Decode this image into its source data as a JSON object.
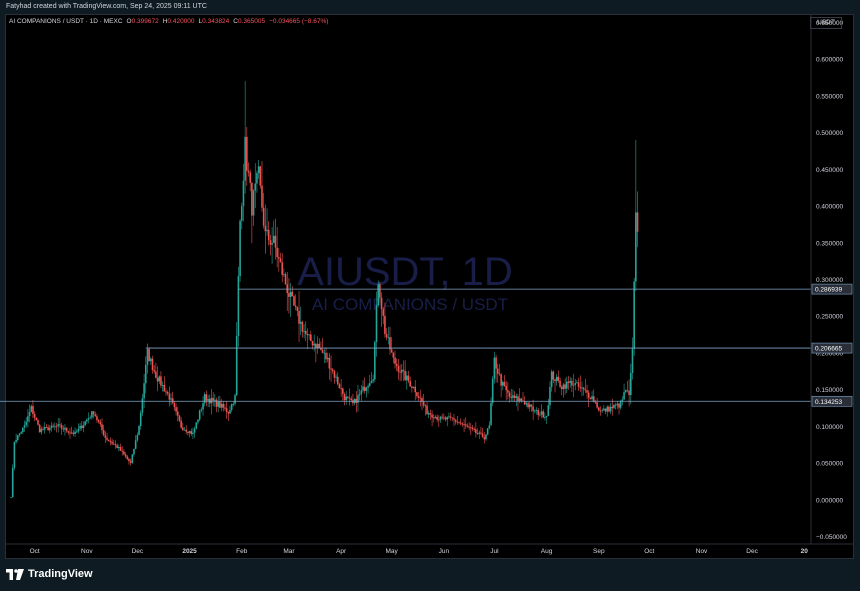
{
  "attribution": "Fatyhad created with TradingView.com, Sep 24, 2025 09:11 UTC",
  "symbol_bar": {
    "title": "AI COMPANIONS / USDT · 1D · MEXC",
    "o_key": "O",
    "o_val": "0.399672",
    "h_key": "H",
    "h_val": "0.420000",
    "l_key": "L",
    "l_val": "0.343824",
    "c_key": "C",
    "c_val": "0.365005",
    "change": "−0.034665 (−8.67%)"
  },
  "currency_badge": "USDT",
  "watermark": {
    "symbol": "AIUSDT, 1D",
    "name": "AI COMPANIONS / USDT"
  },
  "footer": {
    "brand": "TradingView"
  },
  "colors": {
    "up": "#26a69a",
    "down": "#ef5350",
    "background": "#000000",
    "level_line": "#7fa6c9",
    "axis_text": "#d1d4dc"
  },
  "chart_data": {
    "type": "candlestick",
    "symbol": "AIUSDT",
    "timeframe": "1D",
    "exchange": "MEXC",
    "y_axis": {
      "ticks": [
        "0.650000",
        "0.600000",
        "0.550000",
        "0.500000",
        "0.450000",
        "0.400000",
        "0.350000",
        "0.300000",
        "0.250000",
        "0.200000",
        "0.150000",
        "0.100000",
        "0.050000",
        "0.000000",
        "−0.050000"
      ],
      "tick_values": [
        0.65,
        0.6,
        0.55,
        0.5,
        0.45,
        0.4,
        0.35,
        0.3,
        0.25,
        0.2,
        0.15,
        0.1,
        0.05,
        0.0,
        -0.05
      ],
      "range": [
        -0.06,
        0.66
      ]
    },
    "x_axis": {
      "labels": [
        "Oct",
        "Nov",
        "Dec",
        "2025",
        "Feb",
        "Mar",
        "Apr",
        "May",
        "Jun",
        "Jul",
        "Aug",
        "Sep",
        "Oct",
        "Nov",
        "Dec",
        "20"
      ],
      "dates": [
        "2024-10-01",
        "2024-11-01",
        "2024-12-01",
        "2025-01-01",
        "2025-02-01",
        "2025-03-01",
        "2025-04-01",
        "2025-05-01",
        "2025-06-01",
        "2025-07-01",
        "2025-08-01",
        "2025-09-01",
        "2025-10-01",
        "2025-11-01",
        "2025-12-01",
        "2026-01-01"
      ],
      "range": [
        "2024-09-14",
        "2026-01-05"
      ]
    },
    "horizontal_levels": [
      {
        "value": 0.286939,
        "label": "0.286939",
        "from": "2025-01-30"
      },
      {
        "value": 0.206665,
        "label": "0.206665",
        "from": "2024-12-06"
      },
      {
        "value": 0.134253,
        "label": "0.134253",
        "from": "2024-09-10"
      }
    ],
    "last_close": 0.365005,
    "price_path": [
      [
        "2024-09-17",
        0.005
      ],
      [
        "2024-09-19",
        0.08
      ],
      [
        "2024-09-25",
        0.1
      ],
      [
        "2024-09-29",
        0.125
      ],
      [
        "2024-10-04",
        0.095
      ],
      [
        "2024-10-15",
        0.1
      ],
      [
        "2024-10-25",
        0.09
      ],
      [
        "2024-11-05",
        0.12
      ],
      [
        "2024-11-12",
        0.085
      ],
      [
        "2024-11-20",
        0.07
      ],
      [
        "2024-11-27",
        0.05
      ],
      [
        "2024-12-02",
        0.1
      ],
      [
        "2024-12-07",
        0.2
      ],
      [
        "2024-12-12",
        0.17
      ],
      [
        "2024-12-20",
        0.14
      ],
      [
        "2024-12-27",
        0.1
      ],
      [
        "2025-01-03",
        0.09
      ],
      [
        "2025-01-10",
        0.14
      ],
      [
        "2025-01-18",
        0.13
      ],
      [
        "2025-01-24",
        0.12
      ],
      [
        "2025-01-28",
        0.14
      ],
      [
        "2025-01-31",
        0.38
      ],
      [
        "2025-02-03",
        0.48
      ],
      [
        "2025-02-07",
        0.4
      ],
      [
        "2025-02-11",
        0.44
      ],
      [
        "2025-02-15",
        0.36
      ],
      [
        "2025-02-20",
        0.35
      ],
      [
        "2025-02-25",
        0.31
      ],
      [
        "2025-03-01",
        0.28
      ],
      [
        "2025-03-06",
        0.25
      ],
      [
        "2025-03-12",
        0.22
      ],
      [
        "2025-03-18",
        0.21
      ],
      [
        "2025-03-24",
        0.19
      ],
      [
        "2025-03-30",
        0.16
      ],
      [
        "2025-04-03",
        0.14
      ],
      [
        "2025-04-08",
        0.13
      ],
      [
        "2025-04-14",
        0.15
      ],
      [
        "2025-04-20",
        0.17
      ],
      [
        "2025-04-23",
        0.3
      ],
      [
        "2025-04-27",
        0.23
      ],
      [
        "2025-05-02",
        0.19
      ],
      [
        "2025-05-08",
        0.17
      ],
      [
        "2025-05-15",
        0.15
      ],
      [
        "2025-05-22",
        0.12
      ],
      [
        "2025-05-30",
        0.11
      ],
      [
        "2025-06-06",
        0.11
      ],
      [
        "2025-06-14",
        0.1
      ],
      [
        "2025-06-21",
        0.09
      ],
      [
        "2025-06-25",
        0.085
      ],
      [
        "2025-06-28",
        0.1
      ],
      [
        "2025-07-01",
        0.19
      ],
      [
        "2025-07-05",
        0.16
      ],
      [
        "2025-07-10",
        0.14
      ],
      [
        "2025-07-18",
        0.135
      ],
      [
        "2025-07-25",
        0.12
      ],
      [
        "2025-08-01",
        0.115
      ],
      [
        "2025-08-04",
        0.17
      ],
      [
        "2025-08-10",
        0.155
      ],
      [
        "2025-08-16",
        0.16
      ],
      [
        "2025-08-22",
        0.15
      ],
      [
        "2025-08-28",
        0.14
      ],
      [
        "2025-09-02",
        0.12
      ],
      [
        "2025-09-08",
        0.125
      ],
      [
        "2025-09-14",
        0.13
      ],
      [
        "2025-09-17",
        0.15
      ],
      [
        "2025-09-19",
        0.14
      ],
      [
        "2025-09-21",
        0.2
      ],
      [
        "2025-09-22",
        0.29
      ],
      [
        "2025-09-23",
        0.4
      ],
      [
        "2025-09-24",
        0.365
      ]
    ]
  }
}
